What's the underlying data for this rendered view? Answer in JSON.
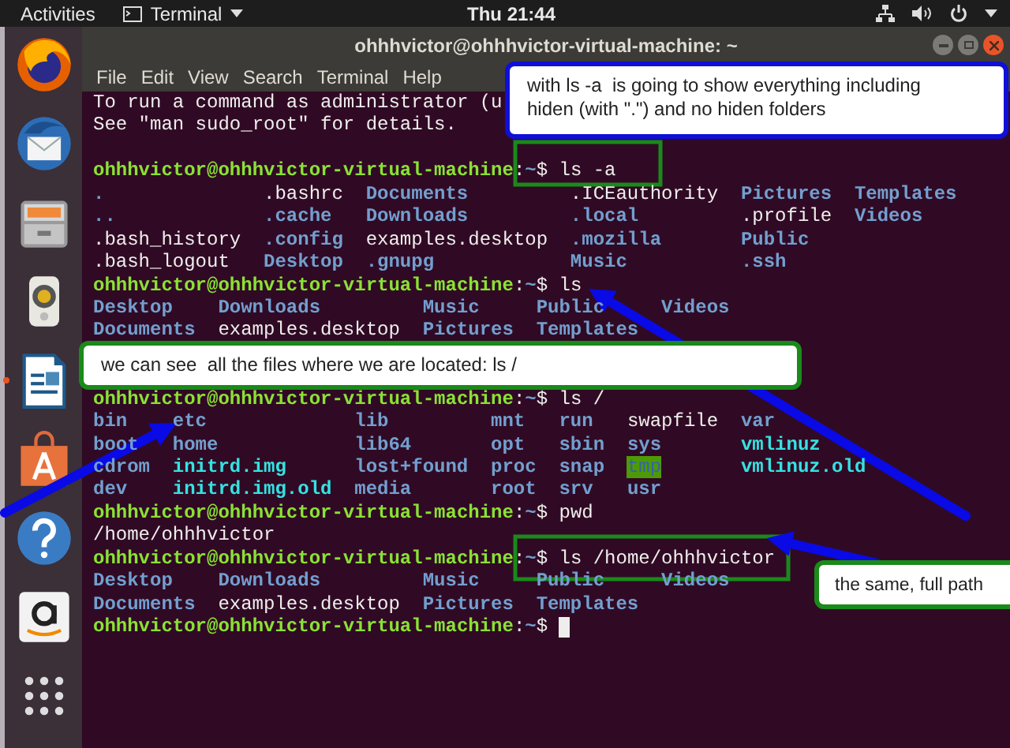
{
  "top_bar": {
    "activities": "Activities",
    "app_menu": "Terminal",
    "clock": "Thu 21:44"
  },
  "dock": {
    "items": [
      {
        "kind": "firefox",
        "running": false
      },
      {
        "kind": "mail",
        "running": false
      },
      {
        "kind": "files",
        "running": false
      },
      {
        "kind": "speaker",
        "running": false
      },
      {
        "kind": "writer",
        "running": true
      },
      {
        "kind": "store",
        "running": false
      },
      {
        "kind": "help",
        "running": false
      },
      {
        "kind": "amazon",
        "running": false
      },
      {
        "kind": "apps",
        "running": false
      }
    ]
  },
  "window": {
    "title": "ohhhvictor@ohhhvictor-virtual-machine: ~",
    "menu": [
      "File",
      "Edit",
      "View",
      "Search",
      "Terminal",
      "Help"
    ]
  },
  "terminal": {
    "lines": [
      {
        "kind": "text",
        "text": "To run a command as administrator (u"
      },
      {
        "kind": "text",
        "text": "See \"man sudo_root\" for details."
      },
      {
        "kind": "blank"
      },
      {
        "kind": "prompt",
        "user": "ohhhvictor@ohhhvictor-virtual-machine",
        "separator": ":",
        "path": "~",
        "symbol": "$",
        "command": "ls -a",
        "cursor": false
      },
      {
        "kind": "listing",
        "rows": [
          [
            {
              "name": ".",
              "kind": "dir"
            },
            {
              "name": ".bashrc",
              "kind": "file"
            },
            {
              "name": "Documents",
              "kind": "dir"
            },
            {
              "name": ".ICEauthority",
              "kind": "file"
            },
            {
              "name": "Pictures",
              "kind": "dir"
            },
            {
              "name": "Templates",
              "kind": "dir"
            }
          ],
          [
            {
              "name": "..",
              "kind": "dir"
            },
            {
              "name": ".cache",
              "kind": "dir"
            },
            {
              "name": "Downloads",
              "kind": "dir"
            },
            {
              "name": ".local",
              "kind": "dir"
            },
            {
              "name": ".profile",
              "kind": "file"
            },
            {
              "name": "Videos",
              "kind": "dir"
            }
          ],
          [
            {
              "name": ".bash_history",
              "kind": "file"
            },
            {
              "name": ".config",
              "kind": "dir"
            },
            {
              "name": "examples.desktop",
              "kind": "file"
            },
            {
              "name": ".mozilla",
              "kind": "dir"
            },
            {
              "name": "Public",
              "kind": "dir"
            }
          ],
          [
            {
              "name": ".bash_logout",
              "kind": "file"
            },
            {
              "name": "Desktop",
              "kind": "dir"
            },
            {
              "name": ".gnupg",
              "kind": "dir"
            },
            {
              "name": "Music",
              "kind": "dir"
            },
            {
              "name": ".ssh",
              "kind": "dir"
            }
          ]
        ]
      },
      {
        "kind": "prompt",
        "user": "ohhhvictor@ohhhvictor-virtual-machine",
        "separator": ":",
        "path": "~",
        "symbol": "$",
        "command": "ls",
        "cursor": false
      },
      {
        "kind": "listing",
        "rows": [
          [
            {
              "name": "Desktop",
              "kind": "dir"
            },
            {
              "name": "Downloads",
              "kind": "dir"
            },
            {
              "name": "Music",
              "kind": "dir"
            },
            {
              "name": "Public",
              "kind": "dir"
            },
            {
              "name": "Videos",
              "kind": "dir"
            }
          ],
          [
            {
              "name": "Documents",
              "kind": "dir"
            },
            {
              "name": "examples.desktop",
              "kind": "file"
            },
            {
              "name": "Pictures",
              "kind": "dir"
            },
            {
              "name": "Templates",
              "kind": "dir"
            }
          ]
        ]
      },
      {
        "kind": "blank"
      },
      {
        "kind": "blank"
      },
      {
        "kind": "prompt",
        "user": "ohhhvictor@ohhhvictor-virtual-machine",
        "separator": ":",
        "path": "~",
        "symbol": "$",
        "command": "ls /",
        "cursor": false
      },
      {
        "kind": "listing",
        "rows": [
          [
            {
              "name": "bin",
              "kind": "dir"
            },
            {
              "name": "etc",
              "kind": "dir"
            },
            {
              "name": "lib",
              "kind": "dir"
            },
            {
              "name": "mnt",
              "kind": "dir"
            },
            {
              "name": "run",
              "kind": "dir"
            },
            {
              "name": "swapfile",
              "kind": "file"
            },
            {
              "name": "var",
              "kind": "dir"
            }
          ],
          [
            {
              "name": "boot",
              "kind": "dir"
            },
            {
              "name": "home",
              "kind": "dir"
            },
            {
              "name": "lib64",
              "kind": "dir"
            },
            {
              "name": "opt",
              "kind": "dir"
            },
            {
              "name": "sbin",
              "kind": "dir"
            },
            {
              "name": "sys",
              "kind": "dir"
            },
            {
              "name": "vmlinuz",
              "kind": "link"
            }
          ],
          [
            {
              "name": "cdrom",
              "kind": "dir"
            },
            {
              "name": "initrd.img",
              "kind": "link"
            },
            {
              "name": "lost+found",
              "kind": "dir"
            },
            {
              "name": "proc",
              "kind": "dir"
            },
            {
              "name": "snap",
              "kind": "dir"
            },
            {
              "name": "tmp",
              "kind": "sticky"
            },
            {
              "name": "vmlinuz.old",
              "kind": "link"
            }
          ],
          [
            {
              "name": "dev",
              "kind": "dir"
            },
            {
              "name": "initrd.img.old",
              "kind": "link"
            },
            {
              "name": "media",
              "kind": "dir"
            },
            {
              "name": "root",
              "kind": "dir"
            },
            {
              "name": "srv",
              "kind": "dir"
            },
            {
              "name": "usr",
              "kind": "dir"
            }
          ]
        ]
      },
      {
        "kind": "prompt",
        "user": "ohhhvictor@ohhhvictor-virtual-machine",
        "separator": ":",
        "path": "~",
        "symbol": "$",
        "command": "pwd",
        "cursor": false
      },
      {
        "kind": "text",
        "text": "/home/ohhhvictor"
      },
      {
        "kind": "prompt",
        "user": "ohhhvictor@ohhhvictor-virtual-machine",
        "separator": ":",
        "path": "~",
        "symbol": "$",
        "command": "ls /home/ohhhvictor",
        "cursor": false
      },
      {
        "kind": "listing",
        "rows": [
          [
            {
              "name": "Desktop",
              "kind": "dir"
            },
            {
              "name": "Downloads",
              "kind": "dir"
            },
            {
              "name": "Music",
              "kind": "dir"
            },
            {
              "name": "Public",
              "kind": "dir"
            },
            {
              "name": "Videos",
              "kind": "dir"
            }
          ],
          [
            {
              "name": "Documents",
              "kind": "dir"
            },
            {
              "name": "examples.desktop",
              "kind": "file"
            },
            {
              "name": "Pictures",
              "kind": "dir"
            },
            {
              "name": "Templates",
              "kind": "dir"
            }
          ]
        ]
      },
      {
        "kind": "prompt",
        "user": "ohhhvictor@ohhhvictor-virtual-machine",
        "separator": ":",
        "path": "~",
        "symbol": "$",
        "cursor": true
      }
    ]
  },
  "annotations": [
    {
      "kind": "blue",
      "text": "with ls -a  is going to show everything including hiden (with \".\") and no hiden folders"
    },
    {
      "kind": "green",
      "text": "we can see  all the files where we are located: ls /"
    },
    {
      "kind": "green_edge",
      "text": "the same, full path"
    }
  ]
}
